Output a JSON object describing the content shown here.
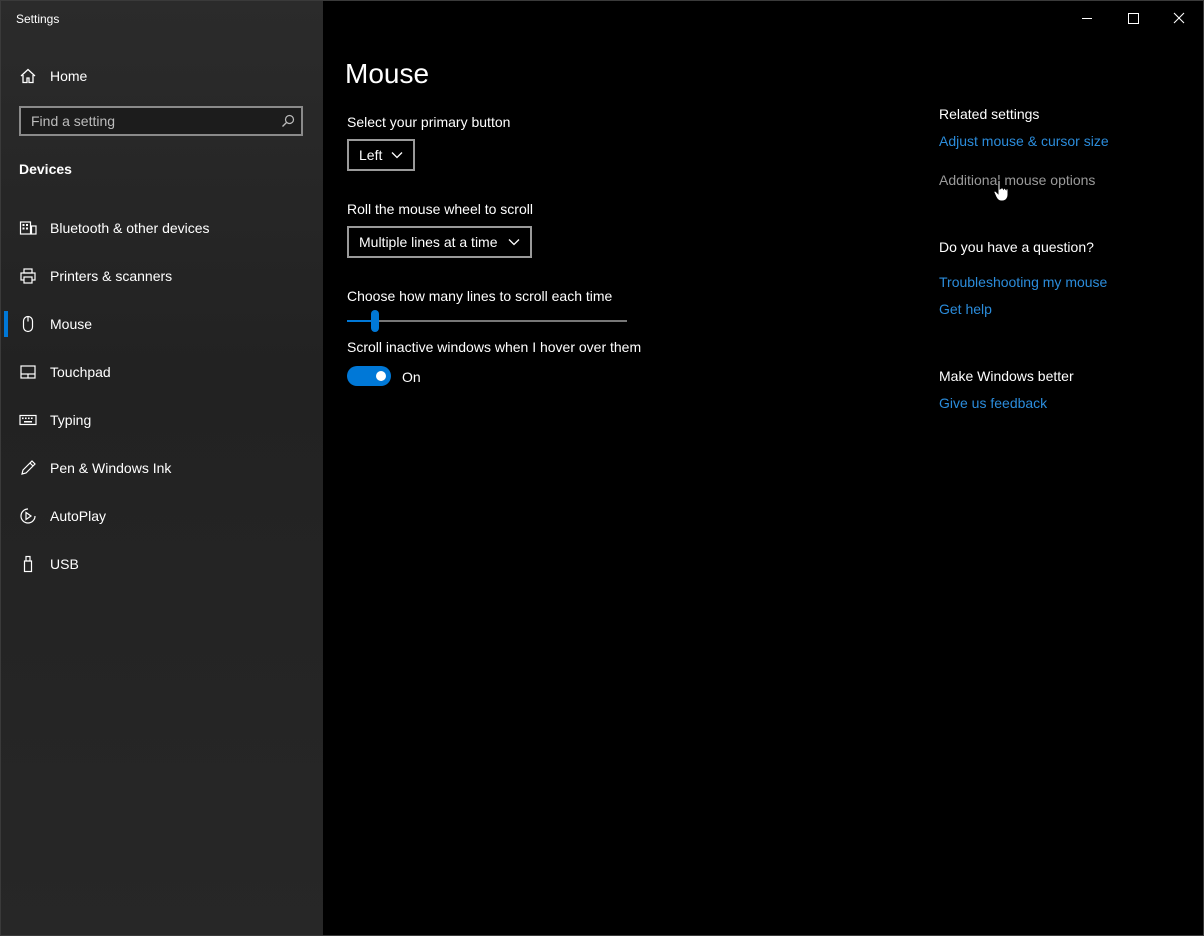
{
  "window": {
    "title": "Settings"
  },
  "sidebar": {
    "home_label": "Home",
    "search_placeholder": "Find a setting",
    "section_title": "Devices",
    "items": [
      {
        "label": "Bluetooth & other devices",
        "icon": "bluetooth-devices-icon"
      },
      {
        "label": "Printers & scanners",
        "icon": "printer-icon"
      },
      {
        "label": "Mouse",
        "icon": "mouse-icon",
        "selected": true
      },
      {
        "label": "Touchpad",
        "icon": "touchpad-icon"
      },
      {
        "label": "Typing",
        "icon": "keyboard-icon"
      },
      {
        "label": "Pen & Windows Ink",
        "icon": "pen-icon"
      },
      {
        "label": "AutoPlay",
        "icon": "autoplay-icon"
      },
      {
        "label": "USB",
        "icon": "usb-icon"
      }
    ]
  },
  "main": {
    "title": "Mouse",
    "primary_button": {
      "label": "Select your primary button",
      "value": "Left"
    },
    "wheel_scroll": {
      "label": "Roll the mouse wheel to scroll",
      "value": "Multiple lines at a time"
    },
    "lines_slider": {
      "label": "Choose how many lines to scroll each time",
      "value_fraction": 0.1
    },
    "inactive_scroll": {
      "label": "Scroll inactive windows when I hover over them",
      "state": "On"
    }
  },
  "related": {
    "heading": "Related settings",
    "link_cursor_size": "Adjust mouse & cursor size",
    "link_additional": "Additional mouse options",
    "question_heading": "Do you have a question?",
    "link_troubleshoot": "Troubleshooting my mouse",
    "link_help": "Get help",
    "better_heading": "Make Windows better",
    "link_feedback": "Give us feedback"
  },
  "colors": {
    "accent": "#0078d7",
    "link": "#2b8cdb",
    "sidebar_bg": "#272727",
    "content_bg": "#000000"
  }
}
